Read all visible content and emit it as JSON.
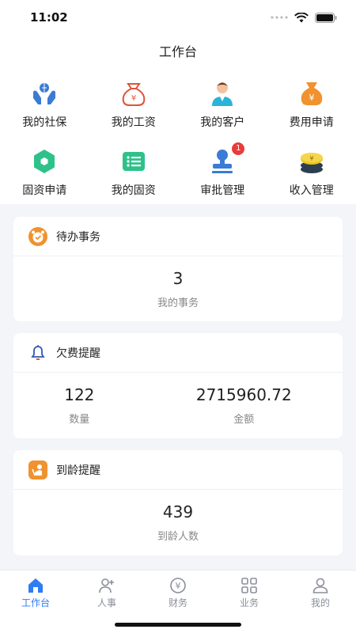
{
  "status": {
    "time": "11:02"
  },
  "header": {
    "title": "工作台"
  },
  "grid": [
    {
      "label": "我的社保",
      "icon": "social-security-icon"
    },
    {
      "label": "我的工资",
      "icon": "money-bag-icon"
    },
    {
      "label": "我的客户",
      "icon": "customer-icon"
    },
    {
      "label": "费用申请",
      "icon": "expense-bag-icon"
    },
    {
      "label": "固资申请",
      "icon": "hexagon-icon"
    },
    {
      "label": "我的固资",
      "icon": "list-icon"
    },
    {
      "label": "审批管理",
      "icon": "stamp-icon",
      "badge": "1"
    },
    {
      "label": "收入管理",
      "icon": "coins-icon"
    }
  ],
  "cards": {
    "todo": {
      "title": "待办事务",
      "value": "3",
      "label": "我的事务"
    },
    "arrears": {
      "title": "欠费提醒",
      "count_value": "122",
      "count_label": "数量",
      "amount_value": "2715960.72",
      "amount_label": "金额"
    },
    "age": {
      "title": "到龄提醒",
      "value": "439",
      "label": "到龄人数"
    }
  },
  "tabs": [
    {
      "label": "工作台",
      "icon": "home-icon"
    },
    {
      "label": "人事",
      "icon": "person-add-icon"
    },
    {
      "label": "财务",
      "icon": "yen-circle-icon"
    },
    {
      "label": "业务",
      "icon": "grid-icon"
    },
    {
      "label": "我的",
      "icon": "profile-icon"
    }
  ],
  "colors": {
    "accent": "#2e7cf6",
    "orange": "#f0922f",
    "badge": "#e93b3b",
    "green": "#2ec28a"
  }
}
